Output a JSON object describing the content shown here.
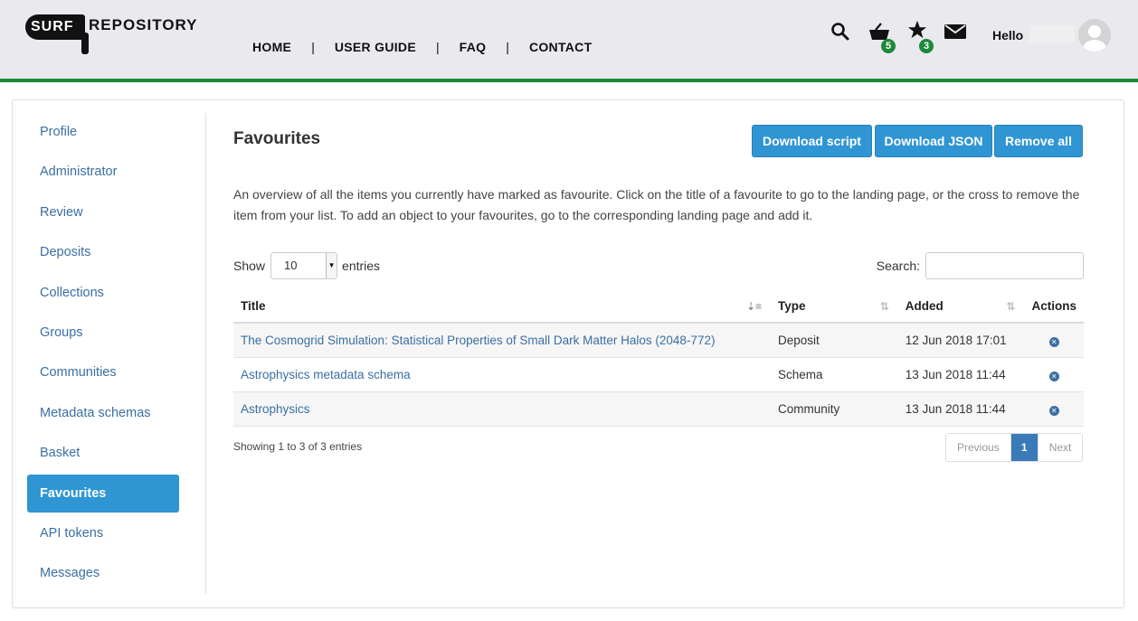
{
  "header": {
    "logo_surf": "SURF",
    "logo_repo": "REPOSITORY",
    "nav": [
      "HOME",
      "USER GUIDE",
      "FAQ",
      "CONTACT"
    ],
    "basket_count": "5",
    "favourites_count": "3",
    "greeting": "Hello",
    "accent_color": "#1d8a3a"
  },
  "sidebar": {
    "items": [
      "Profile",
      "Administrator",
      "Review",
      "Deposits",
      "Collections",
      "Groups",
      "Communities",
      "Metadata schemas",
      "Basket",
      "Favourites",
      "API tokens",
      "Messages"
    ],
    "active": "Favourites"
  },
  "main": {
    "title": "Favourites",
    "buttons": [
      "Download script",
      "Download JSON",
      "Remove all"
    ],
    "description": "An overview of all the items you currently have marked as favourite. Click on the title of a favourite to go to the landing page, or the cross to remove the item from your list. To add an object to your favourites, go to the corresponding landing page and add it.",
    "show_label": "Show",
    "entries_value": "10",
    "entries_label": "entries",
    "search_label": "Search:",
    "table": {
      "columns": [
        "Title",
        "Type",
        "Added",
        "Actions"
      ],
      "rows": [
        {
          "title": "The Cosmogrid Simulation: Statistical Properties of Small Dark Matter Halos (2048-772)",
          "type": "Deposit",
          "added": "12 Jun 2018 17:01"
        },
        {
          "title": "Astrophysics metadata schema",
          "type": "Schema",
          "added": "13 Jun 2018 11:44"
        },
        {
          "title": "Astrophysics",
          "type": "Community",
          "added": "13 Jun 2018 11:44"
        }
      ]
    },
    "info": "Showing 1 to 3 of 3 entries",
    "pager": {
      "previous": "Previous",
      "current": "1",
      "next": "Next"
    }
  }
}
